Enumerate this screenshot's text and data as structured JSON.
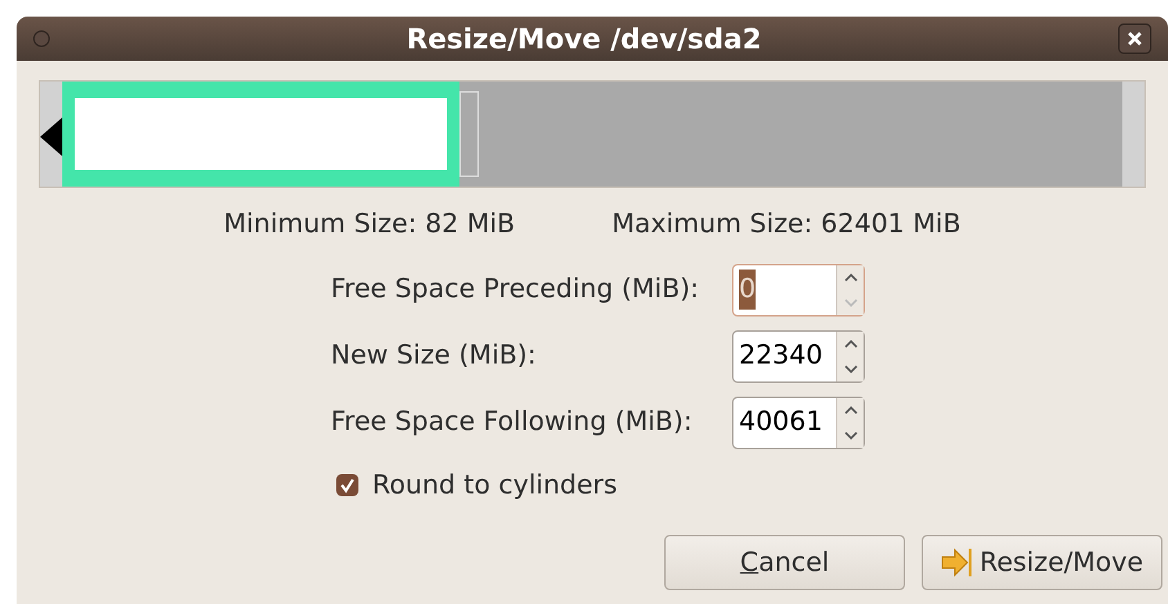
{
  "window": {
    "title": "Resize/Move /dev/sda2"
  },
  "limits": [
    "Minimum Size: 82 MiB",
    "Maximum Size: 62401 MiB"
  ],
  "fields": [
    {
      "label": "Free Space Preceding (MiB):",
      "value": "0",
      "focused": true
    },
    {
      "label": "New Size (MiB):",
      "value": "22340",
      "focused": false
    },
    {
      "label": "Free Space Following (MiB):",
      "value": "40061",
      "focused": false
    }
  ],
  "round_to_cylinders": {
    "label": "Round to cylinders",
    "checked": true
  },
  "buttons": [
    {
      "label": "Cancel",
      "kind": "cancel",
      "underline_first": true
    },
    {
      "label": "Resize/Move",
      "kind": "apply",
      "underline_first": false
    }
  ]
}
